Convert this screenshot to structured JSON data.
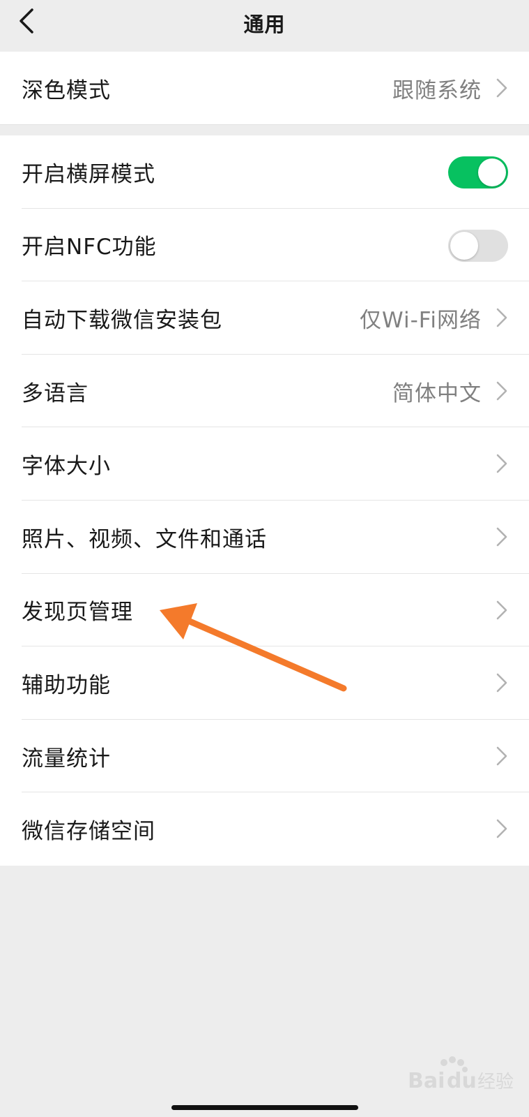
{
  "nav": {
    "title": "通用",
    "back_icon": "chevron-left-icon"
  },
  "dark_mode": {
    "label": "深色模式",
    "value": "跟随系统"
  },
  "settings": [
    {
      "key": "landscape",
      "label": "开启横屏模式",
      "type": "toggle",
      "state": "on"
    },
    {
      "key": "nfc",
      "label": "开启NFC功能",
      "type": "toggle",
      "state": "off"
    },
    {
      "key": "auto-download",
      "label": "自动下载微信安装包",
      "type": "link",
      "value": "仅Wi-Fi网络"
    },
    {
      "key": "language",
      "label": "多语言",
      "type": "link",
      "value": "简体中文"
    },
    {
      "key": "font-size",
      "label": "字体大小",
      "type": "link",
      "value": ""
    },
    {
      "key": "media",
      "label": "照片、视频、文件和通话",
      "type": "link",
      "value": ""
    },
    {
      "key": "discover",
      "label": "发现页管理",
      "type": "link",
      "value": ""
    },
    {
      "key": "accessibility",
      "label": "辅助功能",
      "type": "link",
      "value": ""
    },
    {
      "key": "traffic",
      "label": "流量统计",
      "type": "link",
      "value": ""
    },
    {
      "key": "storage",
      "label": "微信存储空间",
      "type": "link",
      "value": ""
    }
  ],
  "colors": {
    "accent_green": "#07c160",
    "annotation_arrow": "#f47a2b",
    "background": "#ededed"
  },
  "annotation": {
    "icon": "orange-arrow-icon",
    "points_to": "发现页管理"
  },
  "watermark": {
    "text": "Baidu经验"
  }
}
